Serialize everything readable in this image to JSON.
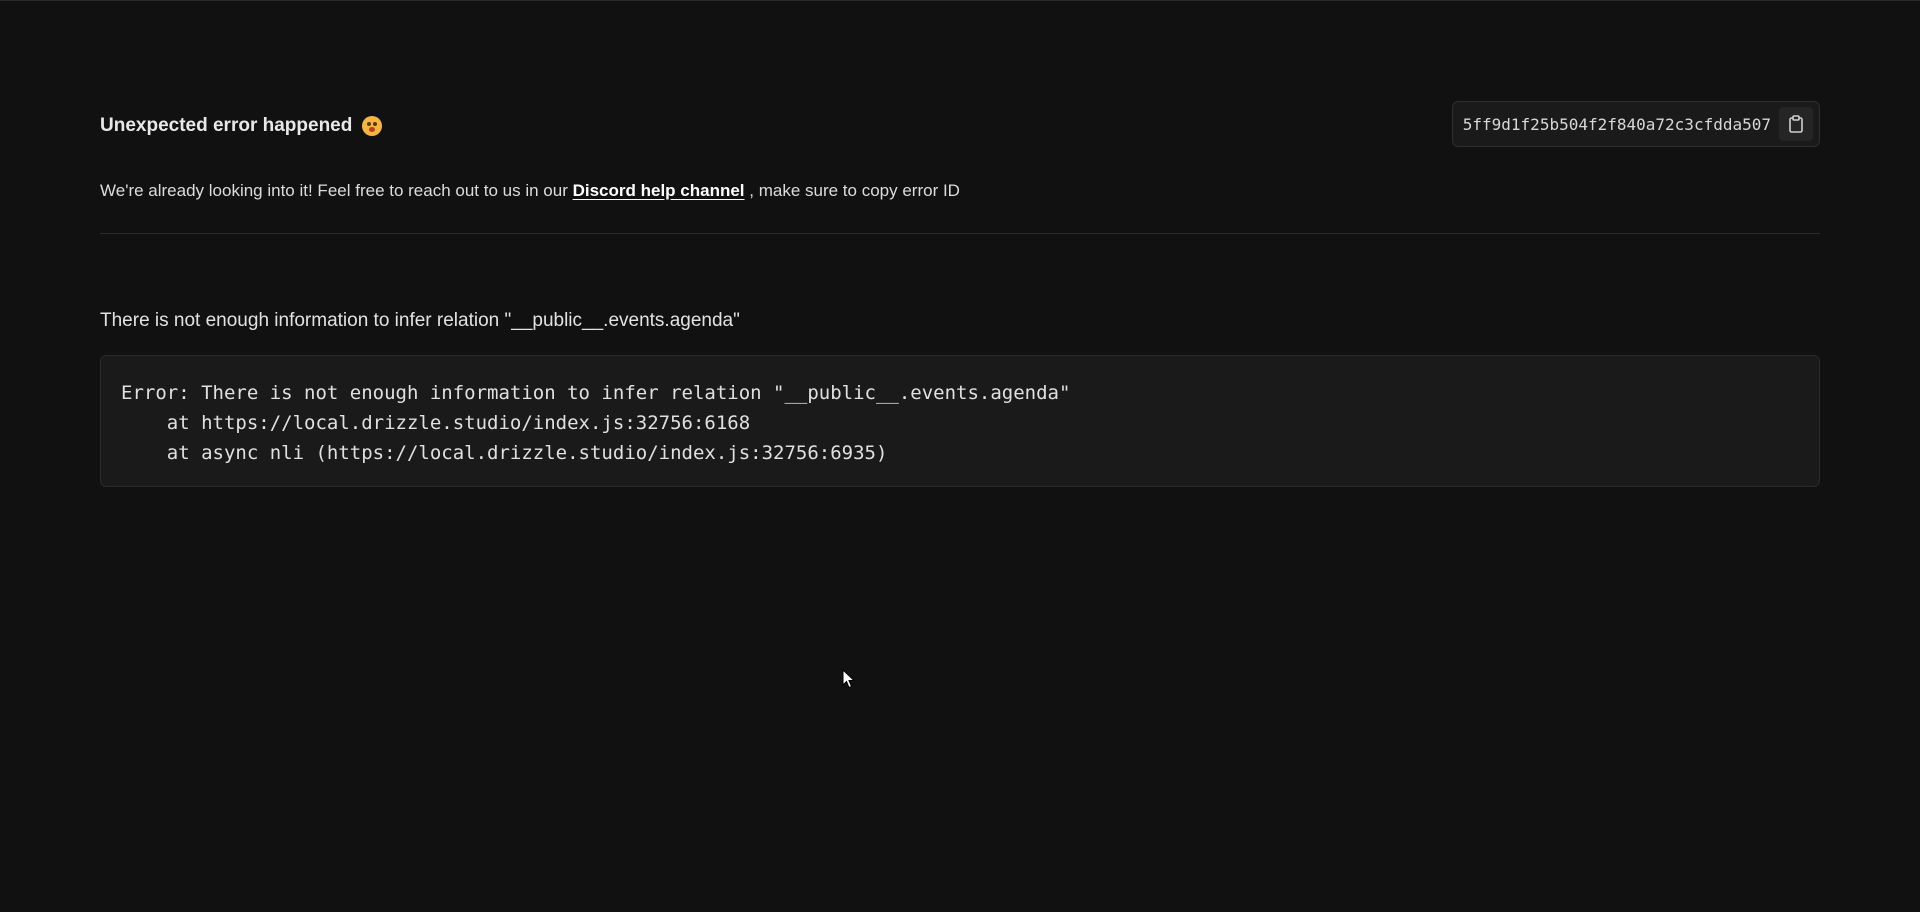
{
  "header": {
    "title": "Unexpected error happened",
    "emoji_icon": "astonished-face-icon",
    "error_id": "5ff9d1f25b504f2f840a72c3cfdda507",
    "copy_icon": "clipboard-icon"
  },
  "subtext": {
    "prefix": "We're already looking into it! Feel free to reach out to us in our",
    "link": "Discord help channel",
    "suffix": ", make sure to copy error ID"
  },
  "error": {
    "message": "There is not enough information to infer relation \"__public__.events.agenda\"",
    "stack": [
      "Error: There is not enough information to infer relation \"__public__.events.agenda\"",
      "    at https://local.drizzle.studio/index.js:32756:6168",
      "    at async nli (https://local.drizzle.studio/index.js:32756:6935)"
    ]
  },
  "colors": {
    "background": "#111111",
    "panel": "#1a1a1a",
    "border": "#2a2a2a",
    "text": "#e6e6e6"
  }
}
